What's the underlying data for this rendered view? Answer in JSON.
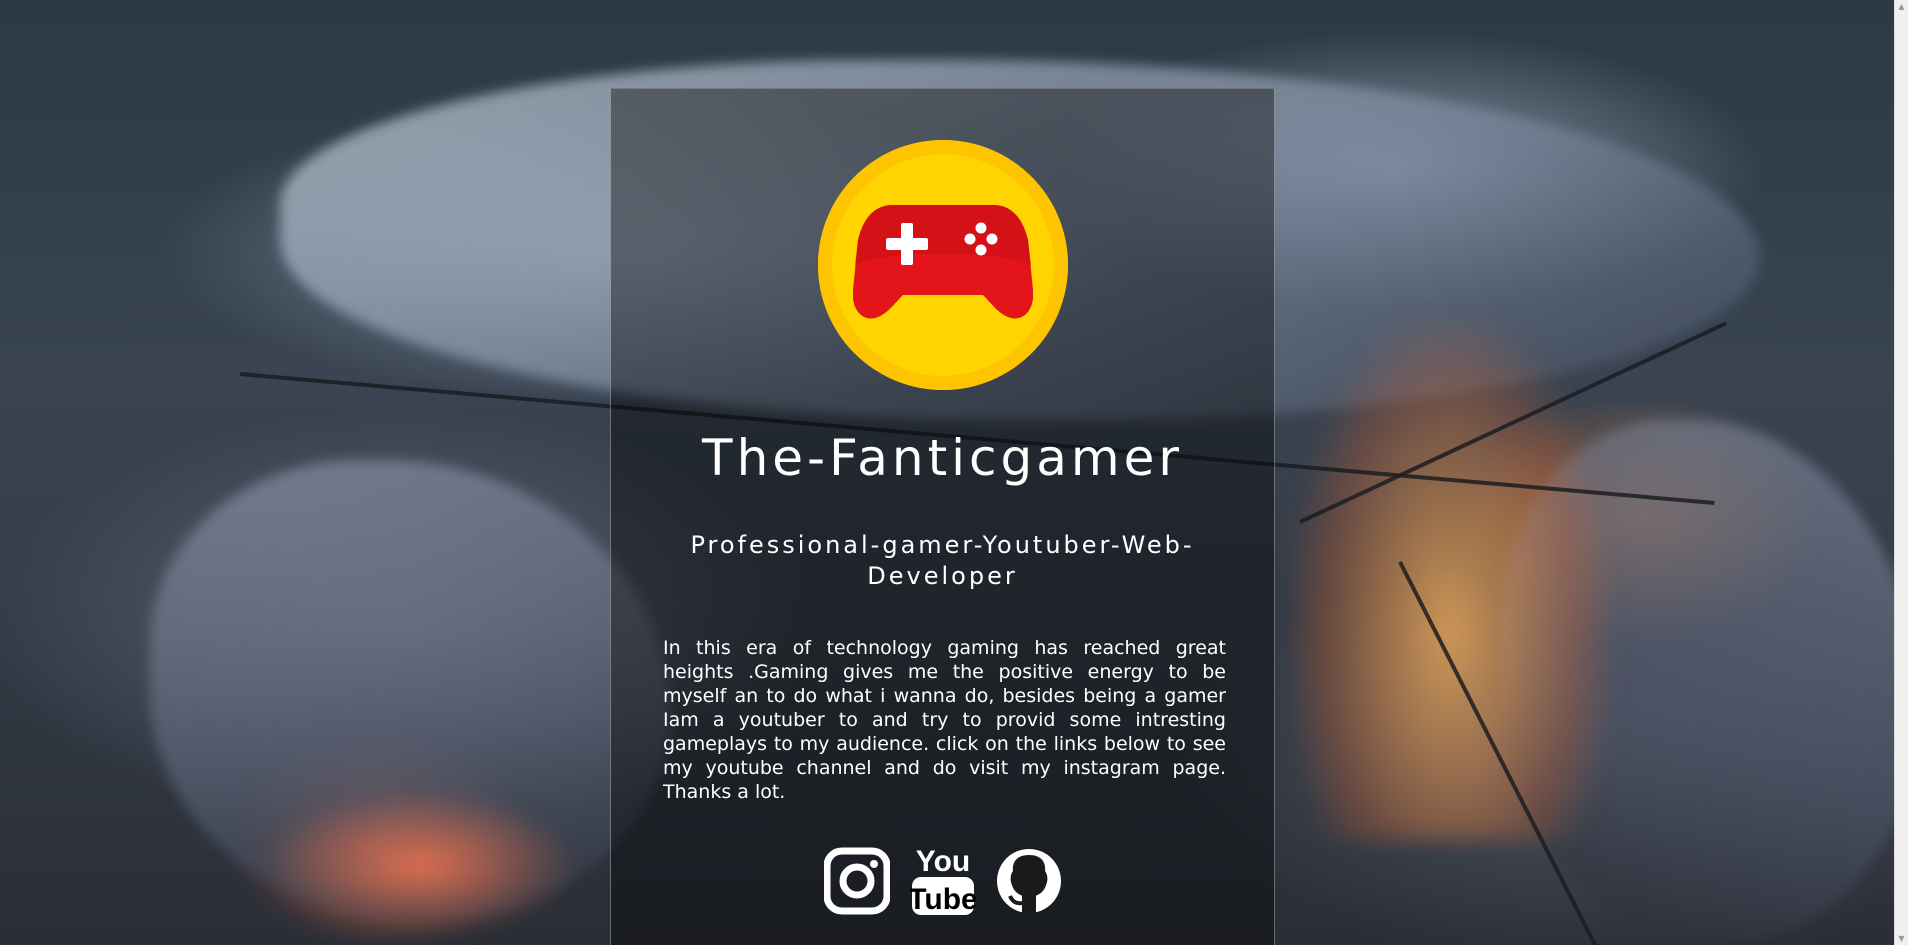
{
  "profile": {
    "logo_icon": "gamepad-icon",
    "title": "The-Fanticgamer",
    "subtitle": "Professional-gamer-Youtuber-Web-Developer",
    "bio": "In this era of technology gaming has reached great heights .Gaming gives me the positive energy to be myself an to do what i wanna do, besides being a gamer Iam a youtuber to and try to provid some intresting gameplays to my audience. click on the links below to see my youtube channel and do visit my instagram page. Thanks a lot."
  },
  "social": {
    "links": [
      {
        "icon": "instagram-icon",
        "label": "Instagram"
      },
      {
        "icon": "youtube-icon",
        "label": "YouTube"
      },
      {
        "icon": "github-icon",
        "label": "GitHub"
      }
    ],
    "youtube_logo_text": [
      "You",
      "Tube"
    ]
  },
  "colors": {
    "logo_circle": "#ffd400",
    "gamepad": "#e4141b",
    "text": "#ffffff"
  }
}
